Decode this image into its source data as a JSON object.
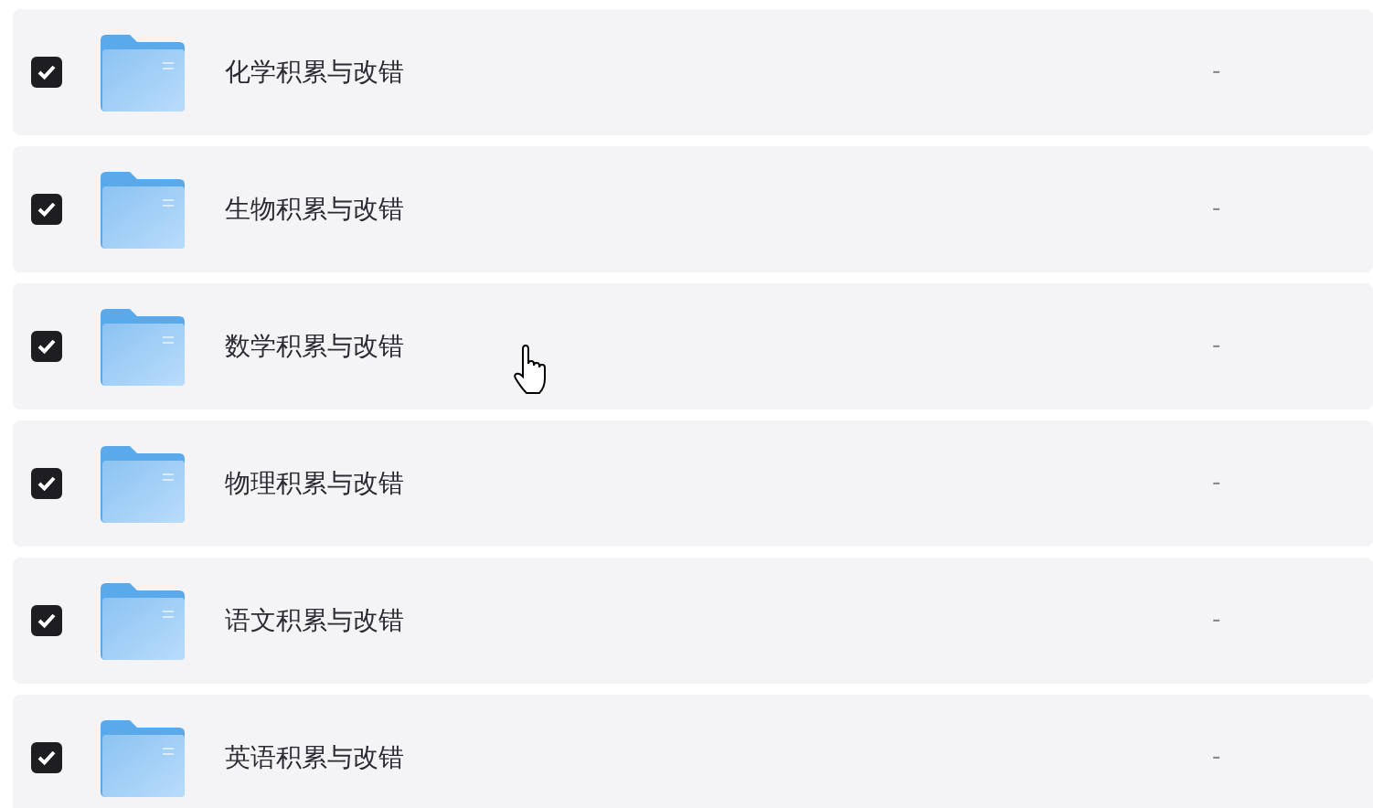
{
  "rows": [
    {
      "name": "化学积累与改错",
      "checked": true,
      "column_2": "-"
    },
    {
      "name": "生物积累与改错",
      "checked": true,
      "column_2": "-"
    },
    {
      "name": "数学积累与改错",
      "checked": true,
      "column_2": "-"
    },
    {
      "name": "物理积累与改错",
      "checked": true,
      "column_2": "-"
    },
    {
      "name": "语文积累与改错",
      "checked": true,
      "column_2": "-"
    },
    {
      "name": "英语积累与改错",
      "checked": true,
      "column_2": "-"
    }
  ]
}
